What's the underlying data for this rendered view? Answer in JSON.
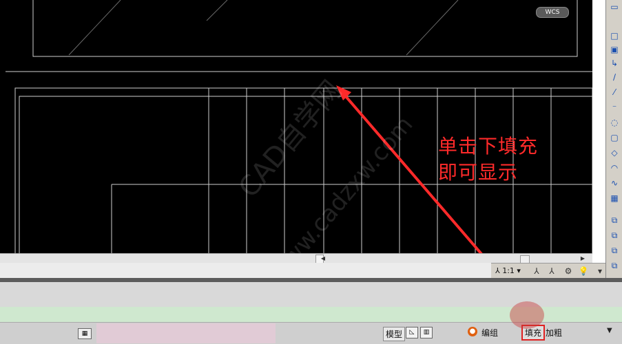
{
  "canvas": {
    "wcs_label": "WCS",
    "annotation_line1": "单击下填充",
    "annotation_line2": "即可显示",
    "watermark": "CAD自学网",
    "watermark_url": "www.cadzxw.com",
    "colors": {
      "background": "#000000",
      "lines": "#cfcfcf",
      "annotation": "#ff2a2a"
    }
  },
  "right_toolbar": {
    "tools": [
      "rectangle-icon",
      "polyline-icon",
      "line-icon",
      "construction-line-icon",
      "ray-icon",
      "xline-icon",
      "spline-icon",
      "arc-icon",
      "circle-icon",
      "revision-cloud-icon",
      "hatch-icon",
      "region-icon",
      "copy-icon",
      "move-icon",
      "draworder-icon",
      "layer-icon"
    ]
  },
  "scale_bar": {
    "scale": "1:1"
  },
  "status_bar": {
    "model_label": "模型",
    "edit_group_label": "编组",
    "fill_label": "填充",
    "bold_label": "加粗"
  }
}
